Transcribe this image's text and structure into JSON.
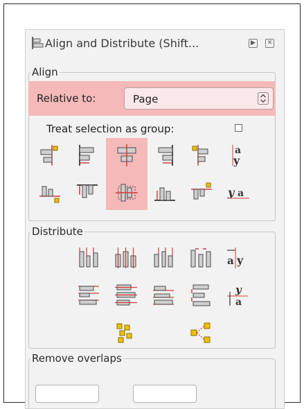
{
  "panel": {
    "title": "Align and Distribute (Shift...",
    "title_icon": "align-distribute-icon",
    "buttons": [
      {
        "name": "expand-panel-button",
        "glyph": "▶"
      },
      {
        "name": "close-panel-button",
        "glyph": "✕"
      }
    ]
  },
  "align": {
    "legend": "Align",
    "relative_label": "Relative to:",
    "relative_value": "Page",
    "treat_label": "Treat selection as group:",
    "treat_checked": false,
    "row1": [
      "align-right-edge-to-left-icon",
      "align-left-edges-icon",
      "center-on-vertical-axis-icon",
      "align-right-edges-icon",
      "align-left-edge-to-right-icon",
      "align-baselines-horizontally-icon"
    ],
    "row2": [
      "align-bottom-edge-to-top-icon",
      "align-top-edges-icon",
      "center-on-horizontal-axis-icon",
      "align-bottom-edges-icon",
      "align-top-edge-to-bottom-icon",
      "align-baselines-vertically-icon"
    ]
  },
  "distribute": {
    "legend": "Distribute",
    "row1": [
      "distribute-left-edges-icon",
      "distribute-centers-horizontally-icon",
      "distribute-right-edges-icon",
      "distribute-gaps-horizontally-icon",
      "distribute-baselines-horizontally-icon"
    ],
    "row2": [
      "distribute-top-edges-icon",
      "distribute-centers-vertically-icon",
      "distribute-bottom-edges-icon",
      "distribute-gaps-vertically-icon",
      "distribute-baselines-vertically-icon"
    ],
    "row3": [
      "randomize-positions-icon",
      "unclump-objects-icon"
    ]
  },
  "remove_overlaps": {
    "legend": "Remove overlaps"
  },
  "colors": {
    "highlight": "#f5b9b9",
    "guide_red": "#d43a3a",
    "object_gray": "#5a5a5a",
    "anchor_yellow": "#f0c000"
  }
}
